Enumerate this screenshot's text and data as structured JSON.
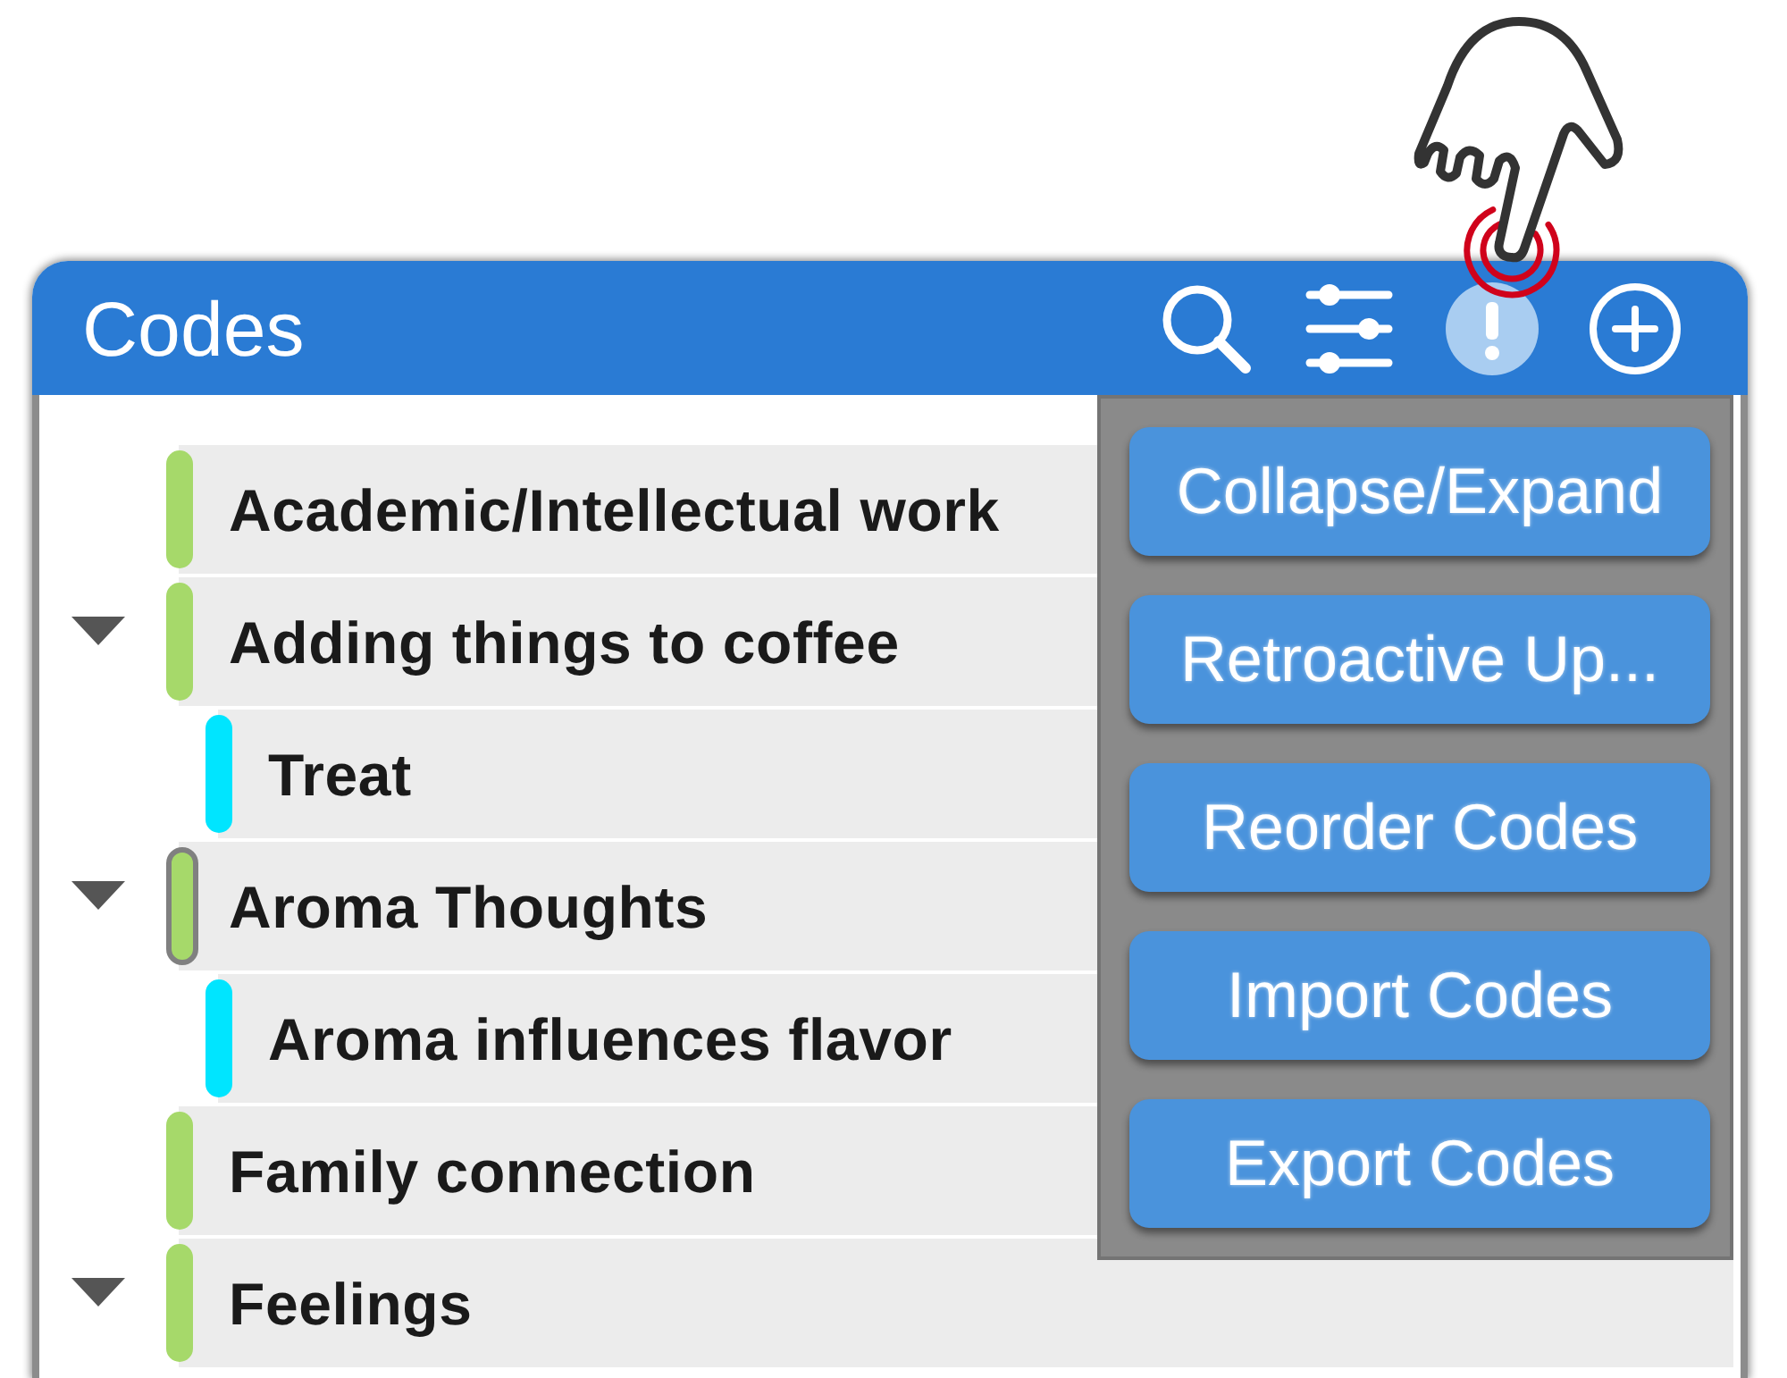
{
  "panel": {
    "title": "Codes",
    "toolbar": [
      {
        "kind": "search",
        "active": false
      },
      {
        "kind": "filter",
        "active": false
      },
      {
        "kind": "alert",
        "active": true
      },
      {
        "kind": "add",
        "active": false
      }
    ]
  },
  "codes": [
    {
      "label": "Academic/Intellectual work",
      "color": "#a6d96a",
      "selected": false
    },
    {
      "label": "Adding things to coffee",
      "color": "#a6d96a",
      "selected": false,
      "expanded": true,
      "children": [
        {
          "label": "Treat",
          "color": "#00e5ff",
          "selected": false
        }
      ]
    },
    {
      "label": "Aroma Thoughts",
      "color": "#a6d96a",
      "selected": true,
      "expanded": true,
      "children": [
        {
          "label": "Aroma influences flavor",
          "color": "#00e5ff",
          "selected": false
        }
      ]
    },
    {
      "label": "Family connection",
      "color": "#a6d96a",
      "selected": false
    },
    {
      "label": "Feelings",
      "color": "#a6d96a",
      "selected": false,
      "expanded": true
    }
  ],
  "menu": {
    "items": [
      "Collapse/Expand",
      "Retroactive Up...",
      "Reorder Codes",
      "Import Codes",
      "Export Codes"
    ]
  }
}
